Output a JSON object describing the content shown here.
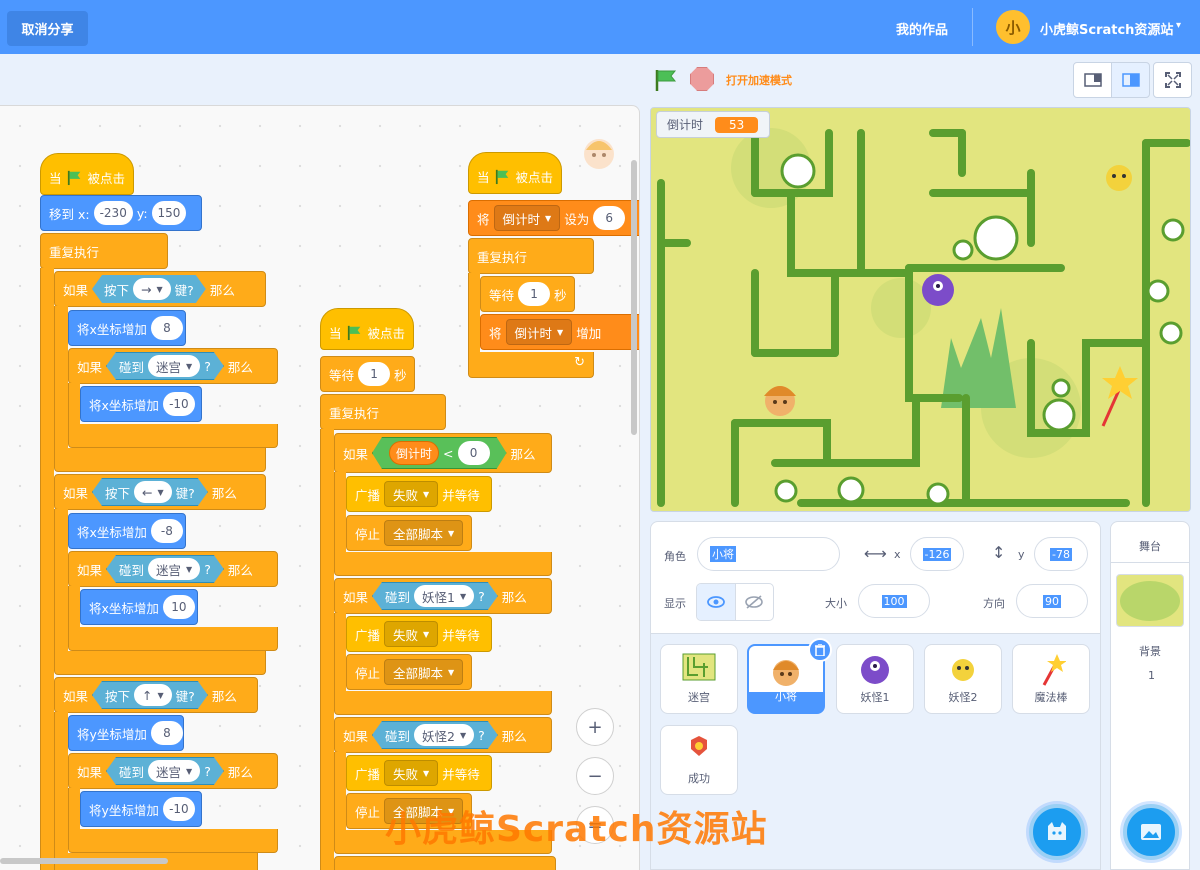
{
  "topbar": {
    "cancel_share": "取消分享",
    "my_works": "我的作品",
    "avatar_text": "小",
    "username": "小虎鲸Scratch资源站",
    "caret": "▾"
  },
  "controls": {
    "turbo": "打开加速模式"
  },
  "stage": {
    "monitor_label": "倒计时",
    "monitor_value": "53"
  },
  "sprite_info": {
    "sprite_label": "角色",
    "sprite_name": "小将",
    "x_label": "x",
    "x_value": "-126",
    "y_label": "y",
    "y_value": "-78",
    "show_label": "显示",
    "size_label": "大小",
    "size_value": "100",
    "direction_label": "方向",
    "direction_value": "90"
  },
  "sprites": [
    {
      "name": "迷宫"
    },
    {
      "name": "小将"
    },
    {
      "name": "妖怪1"
    },
    {
      "name": "妖怪2"
    },
    {
      "name": "魔法棒"
    },
    {
      "name": "成功"
    }
  ],
  "stage_panel": {
    "title": "舞台",
    "backdrop_label": "背景",
    "backdrop_count": "1"
  },
  "zoom": {
    "in": "+",
    "out": "−",
    "reset": "="
  },
  "script1": {
    "hat": {
      "when": "当",
      "clicked": "被点击"
    },
    "goto": {
      "label": "移到 x:",
      "x": "-230",
      "y_label": "y:",
      "y": "150"
    },
    "forever": "重复执行",
    "if1": {
      "if": "如果",
      "press": "按下",
      "key": "→",
      "key_q": "键?",
      "then": "那么"
    },
    "chx1": {
      "label": "将x坐标增加",
      "val": "8"
    },
    "if1b": {
      "if": "如果",
      "touch": "碰到",
      "obj": "迷宫",
      "q": "?",
      "then": "那么"
    },
    "chx1b": {
      "label": "将x坐标增加",
      "val": "-10"
    },
    "if2": {
      "if": "如果",
      "press": "按下",
      "key": "←",
      "key_q": "键?",
      "then": "那么"
    },
    "chx2": {
      "label": "将x坐标增加",
      "val": "-8"
    },
    "if2b": {
      "if": "如果",
      "touch": "碰到",
      "obj": "迷宫",
      "q": "?",
      "then": "那么"
    },
    "chx2b": {
      "label": "将x坐标增加",
      "val": "10"
    },
    "if3": {
      "if": "如果",
      "press": "按下",
      "key": "↑",
      "key_q": "键?",
      "then": "那么"
    },
    "chy3": {
      "label": "将y坐标增加",
      "val": "8"
    },
    "if3b": {
      "if": "如果",
      "touch": "碰到",
      "obj": "迷宫",
      "q": "?",
      "then": "那么"
    },
    "chy3b": {
      "label": "将y坐标增加",
      "val": "-10"
    }
  },
  "script2": {
    "hat": {
      "when": "当",
      "clicked": "被点击"
    },
    "wait": {
      "label": "等待",
      "val": "1",
      "unit": "秒"
    },
    "forever": "重复执行",
    "if1": {
      "if": "如果",
      "var": "倒计时",
      "op": "<",
      "val": "0",
      "then": "那么"
    },
    "bc1": {
      "label": "广播",
      "msg": "失败",
      "wait": "并等待"
    },
    "stop1": {
      "label": "停止",
      "opt": "全部脚本"
    },
    "if2": {
      "if": "如果",
      "touch": "碰到",
      "obj": "妖怪1",
      "q": "?",
      "then": "那么"
    },
    "bc2": {
      "label": "广播",
      "msg": "失败",
      "wait": "并等待"
    },
    "stop2": {
      "label": "停止",
      "opt": "全部脚本"
    },
    "if3": {
      "if": "如果",
      "touch": "碰到",
      "obj": "妖怪2",
      "q": "?",
      "then": "那么"
    },
    "bc3": {
      "label": "广播",
      "msg": "失败",
      "wait": "并等待"
    },
    "stop3": {
      "label": "停止",
      "opt": "全部脚本"
    }
  },
  "script3": {
    "hat": {
      "when": "当",
      "clicked": "被点击"
    },
    "set": {
      "label": "将",
      "var": "倒计时",
      "to": "设为",
      "val": "6"
    },
    "forever": "重复执行",
    "wait": {
      "label": "等待",
      "val": "1",
      "unit": "秒"
    },
    "change": {
      "label": "将",
      "var": "倒计时",
      "by": "增加"
    }
  },
  "watermark": "小虎鲸Scratch资源站",
  "colors": {
    "topbar": "#4c97ff",
    "events": "#ffbf00",
    "motion": "#4c97ff",
    "control": "#ffab19",
    "sensing": "#5cb1d6",
    "operators": "#59c059",
    "variables": "#ff8c1a",
    "maze_wall": "#5a9e2f",
    "stage_bg": "#e6ea8b"
  }
}
